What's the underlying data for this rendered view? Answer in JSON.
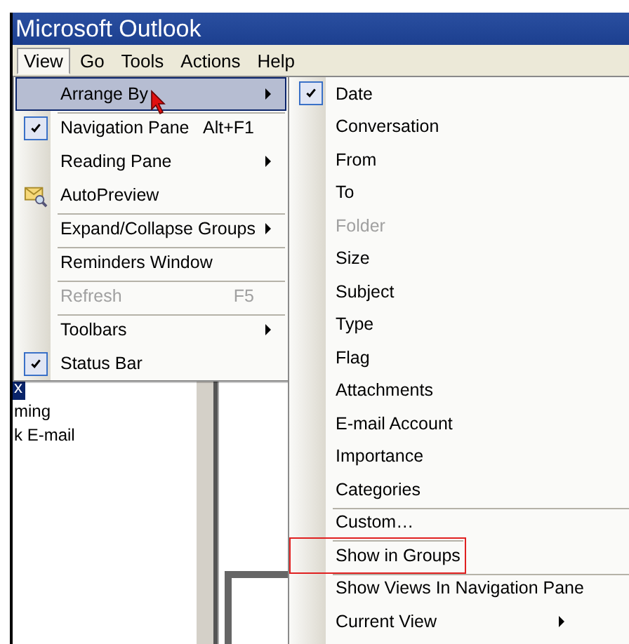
{
  "window": {
    "title": "Microsoft Outlook"
  },
  "menu_bar": [
    {
      "label": "View",
      "selected": true
    },
    {
      "label": "Go",
      "selected": false
    },
    {
      "label": "Tools",
      "selected": false
    },
    {
      "label": "Actions",
      "selected": false
    },
    {
      "label": "Help",
      "selected": false
    }
  ],
  "view_menu": [
    {
      "label": "Arrange By",
      "submenu": true,
      "checked": false,
      "disabled": false,
      "selected": true,
      "has_icon": false,
      "divider_above": false
    },
    {
      "label": "Navigation Pane",
      "shortcut": "Alt+F1",
      "submenu": false,
      "checked": true,
      "disabled": false,
      "selected": false,
      "has_icon": false,
      "divider_above": true
    },
    {
      "label": "Reading Pane",
      "submenu": true,
      "checked": false,
      "disabled": false,
      "selected": false,
      "has_icon": false,
      "divider_above": false
    },
    {
      "label": "AutoPreview",
      "submenu": false,
      "checked": false,
      "disabled": false,
      "selected": false,
      "has_icon": true,
      "divider_above": false
    },
    {
      "label": "Expand/Collapse Groups",
      "submenu": true,
      "checked": false,
      "disabled": false,
      "selected": false,
      "has_icon": false,
      "divider_above": true
    },
    {
      "label": "Reminders Window",
      "submenu": false,
      "checked": false,
      "disabled": false,
      "selected": false,
      "has_icon": false,
      "divider_above": true
    },
    {
      "label": "Refresh",
      "shortcut": "F5",
      "submenu": false,
      "checked": false,
      "disabled": true,
      "selected": false,
      "has_icon": false,
      "divider_above": true
    },
    {
      "label": "Toolbars",
      "submenu": true,
      "checked": false,
      "disabled": false,
      "selected": false,
      "has_icon": false,
      "divider_above": true
    },
    {
      "label": "Status Bar",
      "submenu": false,
      "checked": true,
      "disabled": false,
      "selected": false,
      "has_icon": false,
      "divider_above": false
    }
  ],
  "arrange_by_menu": [
    {
      "label": "Date",
      "submenu": false,
      "checked": true,
      "disabled": false,
      "annotated": false,
      "divider_above": false
    },
    {
      "label": "Conversation",
      "submenu": false,
      "checked": false,
      "disabled": false,
      "annotated": false,
      "divider_above": false
    },
    {
      "label": "From",
      "submenu": false,
      "checked": false,
      "disabled": false,
      "annotated": false,
      "divider_above": false
    },
    {
      "label": "To",
      "submenu": false,
      "checked": false,
      "disabled": false,
      "annotated": false,
      "divider_above": false
    },
    {
      "label": "Folder",
      "submenu": false,
      "checked": false,
      "disabled": true,
      "annotated": false,
      "divider_above": false
    },
    {
      "label": "Size",
      "submenu": false,
      "checked": false,
      "disabled": false,
      "annotated": false,
      "divider_above": false
    },
    {
      "label": "Subject",
      "submenu": false,
      "checked": false,
      "disabled": false,
      "annotated": false,
      "divider_above": false
    },
    {
      "label": "Type",
      "submenu": false,
      "checked": false,
      "disabled": false,
      "annotated": false,
      "divider_above": false
    },
    {
      "label": "Flag",
      "submenu": false,
      "checked": false,
      "disabled": false,
      "annotated": false,
      "divider_above": false
    },
    {
      "label": "Attachments",
      "submenu": false,
      "checked": false,
      "disabled": false,
      "annotated": false,
      "divider_above": false
    },
    {
      "label": "E-mail Account",
      "submenu": false,
      "checked": false,
      "disabled": false,
      "annotated": false,
      "divider_above": false
    },
    {
      "label": "Importance",
      "submenu": false,
      "checked": false,
      "disabled": false,
      "annotated": false,
      "divider_above": false
    },
    {
      "label": "Categories",
      "submenu": false,
      "checked": false,
      "disabled": false,
      "annotated": false,
      "divider_above": false
    },
    {
      "label": "Custom…",
      "submenu": false,
      "checked": false,
      "disabled": false,
      "annotated": false,
      "divider_above": true
    },
    {
      "label": "Show in Groups",
      "submenu": false,
      "checked": false,
      "disabled": false,
      "annotated": true,
      "divider_above": true
    },
    {
      "label": "Show Views In Navigation Pane",
      "submenu": false,
      "checked": false,
      "disabled": false,
      "annotated": false,
      "divider_above": true
    },
    {
      "label": "Current View",
      "submenu": true,
      "checked": false,
      "disabled": false,
      "annotated": false,
      "divider_above": false
    }
  ],
  "folder_list": [
    {
      "label": "x",
      "selected": true
    },
    {
      "label": "ming",
      "selected": false
    },
    {
      "label": "k E-mail",
      "selected": false
    }
  ]
}
